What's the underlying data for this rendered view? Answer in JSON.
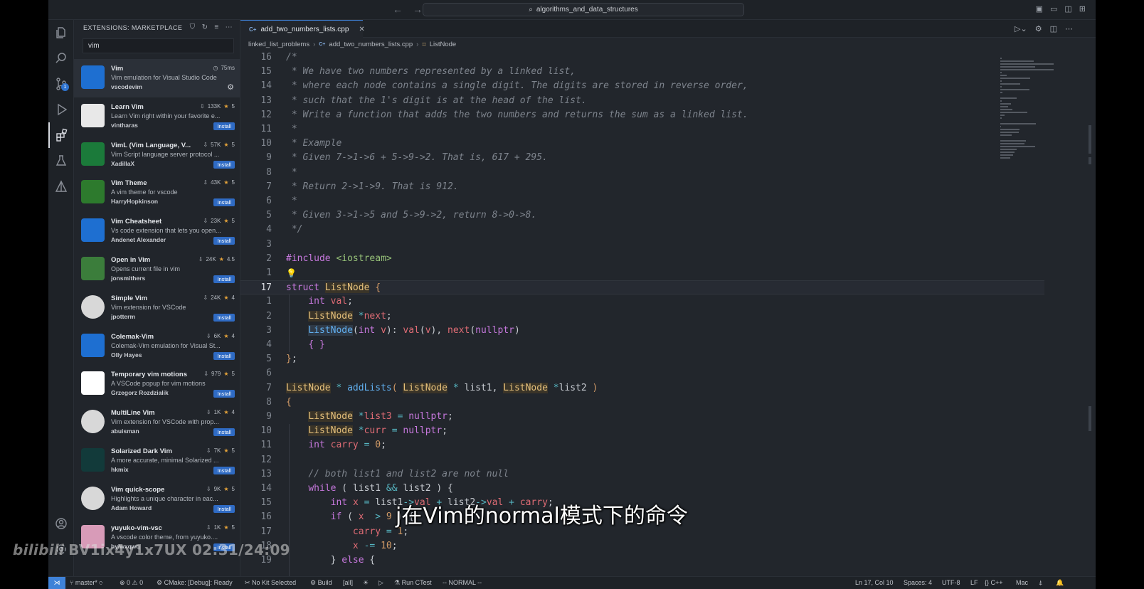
{
  "titlebar": {
    "search": "algorithms_and_data_structures"
  },
  "sidebar": {
    "title": "EXTENSIONS: MARKETPLACE",
    "search_value": "vim",
    "extensions": [
      {
        "name": "Vim",
        "desc": "Vim emulation for Visual Studio Code",
        "publisher": "vscodevim",
        "stats": "75ms",
        "rating": "",
        "action": ""
      },
      {
        "name": "Learn Vim",
        "desc": "Learn Vim right within your favorite e...",
        "publisher": "vintharas",
        "stats": "133K",
        "rating": "5",
        "action": "Install"
      },
      {
        "name": "VimL (Vim Language, V...",
        "desc": "Vim Script language server protocol ...",
        "publisher": "XadillaX",
        "stats": "57K",
        "rating": "5",
        "action": "Install"
      },
      {
        "name": "Vim Theme",
        "desc": "A vim theme for vscode",
        "publisher": "HarryHopkinson",
        "stats": "43K",
        "rating": "5",
        "action": "Install"
      },
      {
        "name": "Vim Cheatsheet",
        "desc": "Vs code extension that lets you open...",
        "publisher": "Andenet Alexander",
        "stats": "23K",
        "rating": "5",
        "action": "Install"
      },
      {
        "name": "Open in Vim",
        "desc": "Opens current file in vim",
        "publisher": "jonsmithers",
        "stats": "24K",
        "rating": "4.5",
        "action": "Install"
      },
      {
        "name": "Simple Vim",
        "desc": "Vim extension for VSCode",
        "publisher": "jpotterm",
        "stats": "24K",
        "rating": "4",
        "action": "Install"
      },
      {
        "name": "Colemak-Vim",
        "desc": "Colemak-Vim emulation for Visual St...",
        "publisher": "Olly Hayes",
        "stats": "6K",
        "rating": "4",
        "action": "Install"
      },
      {
        "name": "Temporary vim motions",
        "desc": "A VSCode popup for vim motions",
        "publisher": "Grzegorz Rozdzialik",
        "stats": "979",
        "rating": "5",
        "action": "Install"
      },
      {
        "name": "MultiLine Vim",
        "desc": "Vim extension for VSCode with prop...",
        "publisher": "abuisman",
        "stats": "1K",
        "rating": "4",
        "action": "Install"
      },
      {
        "name": "Solarized Dark Vim",
        "desc": "A more accurate, minimal Solarized ...",
        "publisher": "hkmix",
        "stats": "7K",
        "rating": "5",
        "action": "Install"
      },
      {
        "name": "Vim quick-scope",
        "desc": "Highlights a unique character in eac...",
        "publisher": "Adam Howard",
        "stats": "9K",
        "rating": "5",
        "action": "Install"
      },
      {
        "name": "yuyuko-vim-vsc",
        "desc": "A vscode color theme, from yuyuko....",
        "publisher": "hylwxqwq",
        "stats": "1K",
        "rating": "5",
        "action": "Install"
      }
    ]
  },
  "editor": {
    "tab": "add_two_numbers_lists.cpp",
    "breadcrumb": [
      "linked_list_problems",
      "add_two_numbers_lists.cpp",
      "ListNode"
    ],
    "lines": [
      {
        "n": "16",
        "html": "<span class='c-cmt'>/*</span>"
      },
      {
        "n": "15",
        "html": "<span class='c-cmt'> * We have two numbers represented by a linked list,</span>"
      },
      {
        "n": "14",
        "html": "<span class='c-cmt'> * where each node contains a single digit. The digits are stored in reverse order,</span>"
      },
      {
        "n": "13",
        "html": "<span class='c-cmt'> * such that the 1's digit is at the head of the list.</span>"
      },
      {
        "n": "12",
        "html": "<span class='c-cmt'> * Write a function that adds the two numbers and returns the sum as a linked list.</span>"
      },
      {
        "n": "11",
        "html": "<span class='c-cmt'> *</span>"
      },
      {
        "n": "10",
        "html": "<span class='c-cmt'> * Example</span>"
      },
      {
        "n": "9",
        "html": "<span class='c-cmt'> * Given 7->1->6 + 5->9->2. That is, 617 + 295.</span>"
      },
      {
        "n": "8",
        "html": "<span class='c-cmt'> *</span>"
      },
      {
        "n": "7",
        "html": "<span class='c-cmt'> * Return 2->1->9. That is 912.</span>"
      },
      {
        "n": "6",
        "html": "<span class='c-cmt'> *</span>"
      },
      {
        "n": "5",
        "html": "<span class='c-cmt'> * Given 3->1->5 and 5->9->2, return 8->0->8.</span>"
      },
      {
        "n": "4",
        "html": "<span class='c-cmt'> */</span>"
      },
      {
        "n": "3",
        "html": ""
      },
      {
        "n": "2",
        "html": "<span class='c-kw'>#include</span> <span class='c-str'>&lt;iostream&gt;</span>"
      },
      {
        "n": "1",
        "html": "<span class='bulb'>💡</span>"
      },
      {
        "n": "17",
        "html": "<span class='c-kw'>struct</span> <span class='c-type'>ListNode</span> <span class='c-bracket'>{</span>",
        "current": true
      },
      {
        "n": "1",
        "html": "    <span class='c-kw'>int</span> <span class='c-var'>val</span>;"
      },
      {
        "n": "2",
        "html": "    <span class='c-type'>ListNode</span> <span class='c-op'>*</span><span class='c-var'>next</span>;"
      },
      {
        "n": "3",
        "html": "    <span class='c-typ2'>ListNode</span>(<span class='c-kw'>int</span> <span class='c-var'>v</span>): <span class='c-var'>val</span>(<span class='c-var'>v</span>), <span class='c-var'>next</span>(<span class='c-kw'>nullptr</span>)"
      },
      {
        "n": "4",
        "html": "    <span class='c-kw'>{ }</span>"
      },
      {
        "n": "5",
        "html": "<span class='c-bracket'>}</span>;"
      },
      {
        "n": "6",
        "html": ""
      },
      {
        "n": "7",
        "html": "<span class='c-type'>ListNode</span> <span class='c-op'>*</span> <span class='c-fn'>addLists</span><span class='c-bracket'>(</span> <span class='c-type'>ListNode</span> <span class='c-op'>*</span> list1, <span class='c-type'>ListNode</span> <span class='c-op'>*</span>list2 <span class='c-bracket'>)</span>"
      },
      {
        "n": "8",
        "html": "<span class='c-bracket'>{</span>"
      },
      {
        "n": "9",
        "html": "    <span class='c-type'>ListNode</span> <span class='c-op'>*</span><span class='c-var'>list3</span> <span class='c-op'>=</span> <span class='c-kw'>nullptr</span>;"
      },
      {
        "n": "10",
        "html": "    <span class='c-type'>ListNode</span> <span class='c-op'>*</span><span class='c-var'>curr</span> <span class='c-op'>=</span> <span class='c-kw'>nullptr</span>;"
      },
      {
        "n": "11",
        "html": "    <span class='c-kw'>int</span> <span class='c-var'>carry</span> <span class='c-op'>=</span> <span class='c-num'>0</span>;"
      },
      {
        "n": "12",
        "html": ""
      },
      {
        "n": "13",
        "html": "    <span class='c-cmt'>// both list1 and list2 are not null</span>"
      },
      {
        "n": "14",
        "html": "    <span class='c-kw'>while</span> ( list1 <span class='c-op'>&amp;&amp;</span> list2 ) {"
      },
      {
        "n": "15",
        "html": "        <span class='c-kw'>int</span> <span class='c-var'>x</span> <span class='c-op'>=</span> list1<span class='c-op'>-&gt;</span><span class='c-var'>val</span> <span class='c-op'>+</span> list2<span class='c-op'>-&gt;</span><span class='c-var'>val</span> <span class='c-op'>+</span> <span class='c-var'>carry</span>;"
      },
      {
        "n": "16",
        "html": "        <span class='c-kw'>if</span> ( <span class='c-var'>x</span>  <span class='c-op'>&gt;</span> <span class='c-num'>9</span> ) {"
      },
      {
        "n": "17",
        "html": "            <span class='c-var'>carry</span> <span class='c-op'>=</span> <span class='c-num'>1</span>;"
      },
      {
        "n": "18",
        "html": "            <span class='c-var'>x</span> <span class='c-op'>-=</span> <span class='c-num'>10</span>;"
      },
      {
        "n": "19",
        "html": "        } <span class='c-kw'>else</span> {"
      }
    ]
  },
  "statusbar": {
    "branch": "master*",
    "problems": "⊗ 0  ⚠ 0",
    "cmake": "CMake: [Debug]: Ready",
    "kit": "No Kit Selected",
    "build": "Build",
    "all": "[all]",
    "ctest": "Run CTest",
    "mode": "-- NORMAL --",
    "position": "Ln 17, Col 10",
    "spaces": "Spaces: 4",
    "encoding": "UTF-8",
    "eol": "LF",
    "lang": "C++",
    "platform": "Mac"
  },
  "overlay": {
    "subtitle": "j在Vim的normal模式下的命令",
    "watermark_logo": "bilibili",
    "watermark_text": "BV1ix4y1x7UX 02:31/24:09"
  }
}
